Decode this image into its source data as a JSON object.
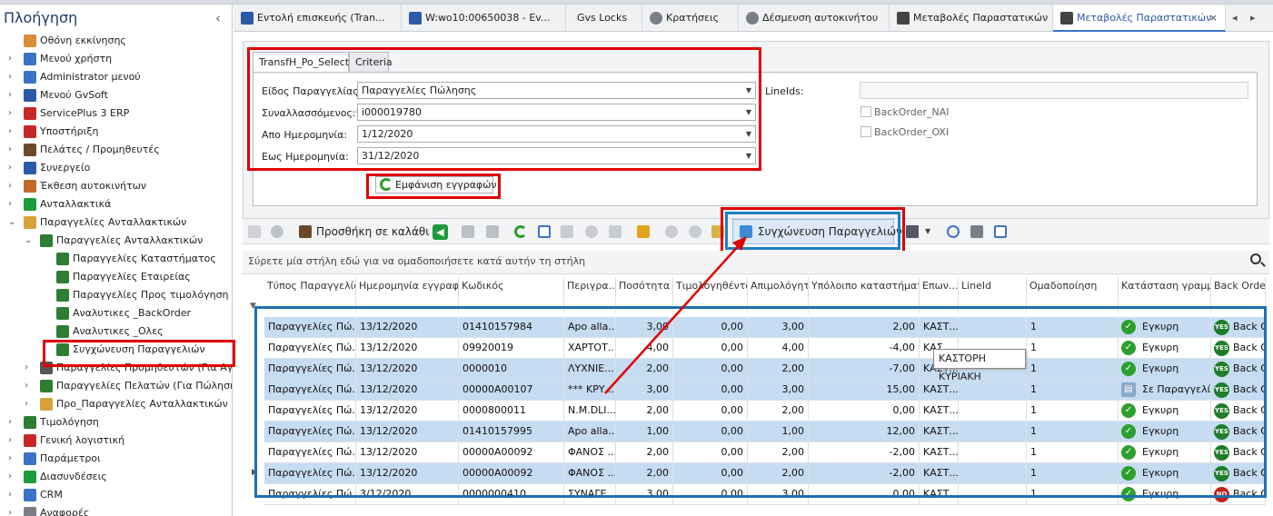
{
  "sidebar": {
    "title": "Πλοήγηση",
    "items": [
      {
        "label": "Οθόνη εκκίνησης",
        "icon": "home-icon",
        "level": 0,
        "expander": "none"
      },
      {
        "label": "Μενού χρήστη",
        "icon": "user-menu-icon",
        "level": 0,
        "expander": "collapsed"
      },
      {
        "label": "Administrator μενού",
        "icon": "admin-icon",
        "level": 0,
        "expander": "collapsed"
      },
      {
        "label": "Μενού GvSoft",
        "icon": "gvsoft-icon",
        "level": 0,
        "expander": "collapsed"
      },
      {
        "label": "ServicePlus 3 ERP",
        "icon": "erp-icon",
        "level": 0,
        "expander": "collapsed"
      },
      {
        "label": "Υποστήριξη",
        "icon": "phone-icon",
        "level": 0,
        "expander": "collapsed"
      },
      {
        "label": "Πελάτες / Προμηθευτές",
        "icon": "customers-icon",
        "level": 0,
        "expander": "collapsed"
      },
      {
        "label": "Συνεργείο",
        "icon": "tools-icon",
        "level": 0,
        "expander": "collapsed"
      },
      {
        "label": "Έκθεση αυτοκινήτων",
        "icon": "car-icon",
        "level": 0,
        "expander": "collapsed"
      },
      {
        "label": "Ανταλλακτικά",
        "icon": "parts-icon",
        "level": 0,
        "expander": "collapsed"
      },
      {
        "label": "Παραγγελίες Ανταλλακτικών",
        "icon": "box-icon",
        "level": 0,
        "expander": "expanded"
      },
      {
        "label": "Παραγγελίες Ανταλλακτικών",
        "icon": "orders-icon",
        "level": 1,
        "expander": "expanded"
      },
      {
        "label": "Παραγγελίες Καταστήματος",
        "icon": "orders-icon",
        "level": 2,
        "expander": "none"
      },
      {
        "label": "Παραγγελίες Εταιρείας",
        "icon": "orders-icon",
        "level": 2,
        "expander": "none"
      },
      {
        "label": "Παραγγελίες Προς τιμολόγηση",
        "icon": "invoice-icon",
        "level": 2,
        "expander": "none"
      },
      {
        "label": "Αναλυτικες _BackOrder",
        "icon": "orders-icon",
        "level": 2,
        "expander": "none"
      },
      {
        "label": "Αναλυτικες _Ολες",
        "icon": "orders-icon",
        "level": 2,
        "expander": "none"
      },
      {
        "label": "Συγχώνευση Παραγγελιών",
        "icon": "orders-icon",
        "level": 2,
        "expander": "none"
      },
      {
        "label": "Παραγγελίες Προμηθευτών (Για Αγορά)",
        "icon": "supplier-icon",
        "level": 1,
        "expander": "collapsed"
      },
      {
        "label": "Παραγγελίες Πελατών (Για Πώληση)",
        "icon": "orders-icon",
        "level": 1,
        "expander": "collapsed"
      },
      {
        "label": "Προ_Παραγγελίες Ανταλλακτικών",
        "icon": "box-icon",
        "level": 1,
        "expander": "collapsed"
      },
      {
        "label": "Τιμολόγηση",
        "icon": "invoice-icon",
        "level": 0,
        "expander": "collapsed"
      },
      {
        "label": "Γενική λογιστική",
        "icon": "gl-icon",
        "level": 0,
        "expander": "collapsed"
      },
      {
        "label": "Παράμετροι",
        "icon": "params-icon",
        "level": 0,
        "expander": "collapsed"
      },
      {
        "label": "Διασυνδέσεις",
        "icon": "link-icon",
        "level": 0,
        "expander": "collapsed"
      },
      {
        "label": "CRM",
        "icon": "crm-icon",
        "level": 0,
        "expander": "collapsed"
      },
      {
        "label": "Αναφορές",
        "icon": "reports-icon",
        "level": 0,
        "expander": "collapsed"
      }
    ]
  },
  "tabs": [
    {
      "label": "Εντολή επισκευής (Tran...",
      "icon": "tools-icon",
      "active": false
    },
    {
      "label": "W:wo10:00650038 - Ev...",
      "icon": "tools-icon",
      "active": false
    },
    {
      "label": "Gvs Locks",
      "icon": "",
      "active": false
    },
    {
      "label": "Κρατήσεις",
      "icon": "clock-icon",
      "active": false
    },
    {
      "label": "Δέσμευση αυτοκινήτου",
      "icon": "clock-icon",
      "active": false
    },
    {
      "label": "Μεταβολές Παραστατικών",
      "icon": "document-icon",
      "active": false
    },
    {
      "label": "Μεταβολές Παραστατικών",
      "icon": "document-icon",
      "active": true
    }
  ],
  "criteria": {
    "tabs": [
      "TransfH_Po_Select",
      "Criteria"
    ],
    "fields": [
      {
        "label": "Είδος Παραγγελίας:",
        "value": "Παραγγελίες Πώλησης",
        "required": false
      },
      {
        "label": "Συναλλασσόμενος:",
        "value": "i000019780",
        "required": true
      },
      {
        "label": "Απο Ημερομηνία:",
        "value": "1/12/2020",
        "required": false
      },
      {
        "label": "Εως  Ημερομηνία:",
        "value": "31/12/2020",
        "required": false
      }
    ],
    "lineids_label": "LineIds:",
    "lineids_value": "",
    "backorder_yes": "BackOrder_NAI",
    "backorder_no": "BackOrder_OXI",
    "show_button": "Εμφάνιση εγγραφών"
  },
  "toolbar": {
    "add_to_cart": "Προσθήκη σε καλάθι",
    "merge_orders": "Συγχώνευση Παραγγελιών"
  },
  "grid": {
    "group_hint": "Σύρετε μία στήλη εδώ για να ομαδοποιήσετε κατά αυτήν τη στήλη",
    "columns": [
      "Τύπος Παραγγελίας",
      "Ημερομηνία εγγραφής",
      "Κωδικός",
      "Περιγρα...",
      "Ποσότητα",
      "Τιμολογηθέντα",
      "Απιμολόγητα",
      "Υπόλοιπο καταστήματος",
      "Επων...",
      "LineId",
      "Ομαδοποίηση",
      "Κατάσταση γραμμής",
      "Back Order"
    ],
    "rows": [
      {
        "type": "Παραγγελίες Πώ...",
        "date": "13/12/2020",
        "code": "01410157984",
        "desc": "Apo alla...",
        "qty": "3,00",
        "invoiced": "0,00",
        "uninvoiced": "3,00",
        "balance": "2,00",
        "name": "ΚΑΣΤ...",
        "lineid": "",
        "group": "1",
        "status": "Εγκυρη",
        "status_icon": "ok",
        "bo": "Back O",
        "bo_icon": "yes",
        "style": "A"
      },
      {
        "type": "Παραγγελίες Πώ...",
        "date": "13/12/2020",
        "code": "09920019",
        "desc": "ΧΑΡΤΟΤ...",
        "qty": "4,00",
        "invoiced": "0,00",
        "uninvoiced": "4,00",
        "balance": "-4,00",
        "name": "ΚΑΣ",
        "lineid": "",
        "group": "1",
        "status": "Εγκυρη",
        "status_icon": "ok",
        "bo": "Back O",
        "bo_icon": "yes",
        "style": "B"
      },
      {
        "type": "Παραγγελίες Πώ...",
        "date": "13/12/2020",
        "code": "0000010",
        "desc": "ΛΥΧΝΙΕ...",
        "qty": "2,00",
        "invoiced": "0,00",
        "uninvoiced": "2,00",
        "balance": "-7,00",
        "name": "ΚΑΣΤ...",
        "lineid": "",
        "group": "1",
        "status": "Εγκυρη",
        "status_icon": "ok",
        "bo": "Back O",
        "bo_icon": "yes",
        "style": "A"
      },
      {
        "type": "Παραγγελίες Πώ...",
        "date": "13/12/2020",
        "code": "00000A00107",
        "desc": "*** ΚΡΥ...",
        "qty": "3,00",
        "invoiced": "0,00",
        "uninvoiced": "3,00",
        "balance": "15,00",
        "name": "ΚΑΣΤ...",
        "lineid": "",
        "group": "1",
        "status": "Σε Παραγγελί...",
        "status_icon": "order",
        "bo": "Back O",
        "bo_icon": "yes",
        "style": "A"
      },
      {
        "type": "Παραγγελίες Πώ...",
        "date": "13/12/2020",
        "code": "0000800011",
        "desc": "N.M.DLI...",
        "qty": "2,00",
        "invoiced": "0,00",
        "uninvoiced": "2,00",
        "balance": "0,00",
        "name": "ΚΑΣΤ...",
        "lineid": "",
        "group": "1",
        "status": "Εγκυρη",
        "status_icon": "ok",
        "bo": "Back O",
        "bo_icon": "yes",
        "style": "B"
      },
      {
        "type": "Παραγγελίες Πώ...",
        "date": "13/12/2020",
        "code": "01410157995",
        "desc": "Apo alla...",
        "qty": "1,00",
        "invoiced": "0,00",
        "uninvoiced": "1,00",
        "balance": "12,00",
        "name": "ΚΑΣΤ...",
        "lineid": "",
        "group": "1",
        "status": "Εγκυρη",
        "status_icon": "ok",
        "bo": "Back O",
        "bo_icon": "yes",
        "style": "A"
      },
      {
        "type": "Παραγγελίες Πώ...",
        "date": "13/12/2020",
        "code": "00000A00092",
        "desc": "ΦΑΝΟΣ ...",
        "qty": "2,00",
        "invoiced": "0,00",
        "uninvoiced": "2,00",
        "balance": "-2,00",
        "name": "ΚΑΣΤ...",
        "lineid": "",
        "group": "1",
        "status": "Εγκυρη",
        "status_icon": "ok",
        "bo": "Back O",
        "bo_icon": "yes",
        "style": "B"
      },
      {
        "type": "Παραγγελίες Πώ...",
        "date": "13/12/2020",
        "code": "00000A00092",
        "desc": "ΦΑΝΟΣ ...",
        "qty": "2,00",
        "invoiced": "0,00",
        "uninvoiced": "2,00",
        "balance": "-2,00",
        "name": "ΚΑΣΤ...",
        "lineid": "",
        "group": "1",
        "status": "Εγκυρη",
        "status_icon": "ok",
        "bo": "Back O",
        "bo_icon": "yes",
        "style": "A"
      },
      {
        "type": "Παραγγελίες Πώ...",
        "date": "3/12/2020",
        "code": "0000000410",
        "desc": "ΣΥΝΑΓΕ...",
        "qty": "3,00",
        "invoiced": "0,00",
        "uninvoiced": "3,00",
        "balance": "0,00",
        "name": "ΚΑΣΤ...",
        "lineid": "",
        "group": "1",
        "status": "Εγκυρη",
        "status_icon": "ok",
        "bo": "Back O",
        "bo_icon": "no",
        "style": "B"
      }
    ],
    "tooltip": "ΚΑΣΤΟΡΗ ΚΥΡΙΑΚΗ"
  },
  "colors": {
    "highlight_red": "#e00000",
    "highlight_blue": "#1f6fb0",
    "row_selected": "#c5dcf2",
    "ok_green": "#2ca02c"
  }
}
